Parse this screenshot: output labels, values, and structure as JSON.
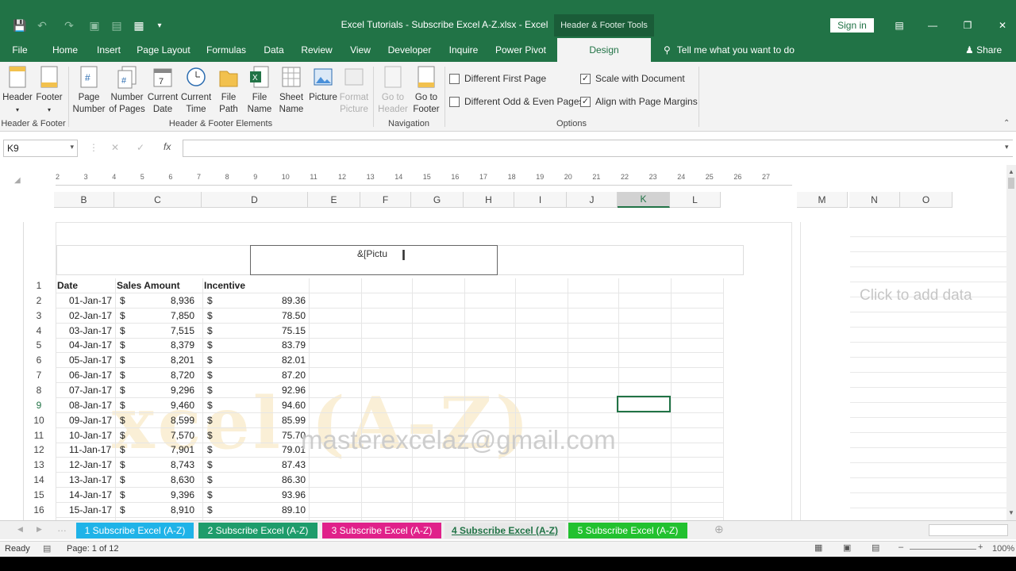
{
  "window": {
    "title": "Excel Tutorials - Subscribe Excel A-Z.xlsx  -  Excel",
    "contextual_tab": "Header & Footer Tools",
    "signin": "Sign in"
  },
  "tabs": [
    "File",
    "Home",
    "Insert",
    "Page Layout",
    "Formulas",
    "Data",
    "Review",
    "View",
    "Developer",
    "Inquire",
    "Power Pivot",
    "Design"
  ],
  "tell_me": "Tell me what you want to do",
  "share": "Share",
  "ribbon": {
    "header": "Header",
    "footer": "Footer",
    "page_number": [
      "Page",
      "Number"
    ],
    "number_of_pages": [
      "Number",
      "of Pages"
    ],
    "current_date": [
      "Current",
      "Date"
    ],
    "current_time": [
      "Current",
      "Time"
    ],
    "file_path": [
      "File",
      "Path"
    ],
    "file_name": [
      "File",
      "Name"
    ],
    "sheet_name": [
      "Sheet",
      "Name"
    ],
    "picture": "Picture",
    "format_picture": [
      "Format",
      "Picture"
    ],
    "goto_header": [
      "Go to",
      "Header"
    ],
    "goto_footer": [
      "Go to",
      "Footer"
    ],
    "group_hf": "Header & Footer",
    "group_elements": "Header & Footer Elements",
    "group_nav": "Navigation",
    "group_options": "Options",
    "opt_first": "Different First Page",
    "opt_oddeven": "Different Odd & Even Pages",
    "opt_scale": "Scale with Document",
    "opt_align": "Align with Page Margins"
  },
  "namebox": "K9",
  "columns": [
    "B",
    "C",
    "D",
    "E",
    "F",
    "G",
    "H",
    "I",
    "J",
    "K",
    "L",
    "M",
    "N",
    "O"
  ],
  "ruler": [
    "2",
    "3",
    "4",
    "5",
    "6",
    "7",
    "8",
    "9",
    "10",
    "11",
    "12",
    "13",
    "14",
    "15",
    "16",
    "17",
    "18",
    "19",
    "20",
    "21",
    "22",
    "23",
    "24",
    "25",
    "26",
    "27"
  ],
  "header_text": "&[Pictu",
  "table": {
    "headers": [
      "Date",
      "Sales Amount",
      "Incentive"
    ],
    "rows": [
      [
        "01-Jan-17",
        "$",
        "8,936",
        "$",
        "89.36"
      ],
      [
        "02-Jan-17",
        "$",
        "7,850",
        "$",
        "78.50"
      ],
      [
        "03-Jan-17",
        "$",
        "7,515",
        "$",
        "75.15"
      ],
      [
        "04-Jan-17",
        "$",
        "8,379",
        "$",
        "83.79"
      ],
      [
        "05-Jan-17",
        "$",
        "8,201",
        "$",
        "82.01"
      ],
      [
        "06-Jan-17",
        "$",
        "8,720",
        "$",
        "87.20"
      ],
      [
        "07-Jan-17",
        "$",
        "9,296",
        "$",
        "92.96"
      ],
      [
        "08-Jan-17",
        "$",
        "9,460",
        "$",
        "94.60"
      ],
      [
        "09-Jan-17",
        "$",
        "8,599",
        "$",
        "85.99"
      ],
      [
        "10-Jan-17",
        "$",
        "7,570",
        "$",
        "75.70"
      ],
      [
        "11-Jan-17",
        "$",
        "7,901",
        "$",
        "79.01"
      ],
      [
        "12-Jan-17",
        "$",
        "8,743",
        "$",
        "87.43"
      ],
      [
        "13-Jan-17",
        "$",
        "8,630",
        "$",
        "86.30"
      ],
      [
        "14-Jan-17",
        "$",
        "9,396",
        "$",
        "93.96"
      ],
      [
        "15-Jan-17",
        "$",
        "8,910",
        "$",
        "89.10"
      ]
    ]
  },
  "row_numbers": [
    "1",
    "2",
    "3",
    "4",
    "5",
    "6",
    "7",
    "8",
    "9",
    "10",
    "11",
    "12",
    "13",
    "14",
    "15",
    "16"
  ],
  "watermark_logo": "xcel (A-Z)",
  "watermark_email": "masterexcelaz@gmail.com",
  "click_to_add": "Click to add data",
  "sheet_tabs": [
    {
      "label": "1 Subscribe Excel (A-Z)",
      "color": "#1fb3e8"
    },
    {
      "label": "2 Subscribe Excel (A-Z)",
      "color": "#1e9c6b"
    },
    {
      "label": "3 Subscribe Excel (A-Z)",
      "color": "#e0218a"
    },
    {
      "label": "4 Subscribe Excel (A-Z)",
      "color": "#e6e6e6"
    },
    {
      "label": "5 Subscribe Excel (A-Z)",
      "color": "#22c12f"
    }
  ],
  "status": {
    "ready": "Ready",
    "page": "Page: 1 of 12",
    "zoom": "100%"
  }
}
